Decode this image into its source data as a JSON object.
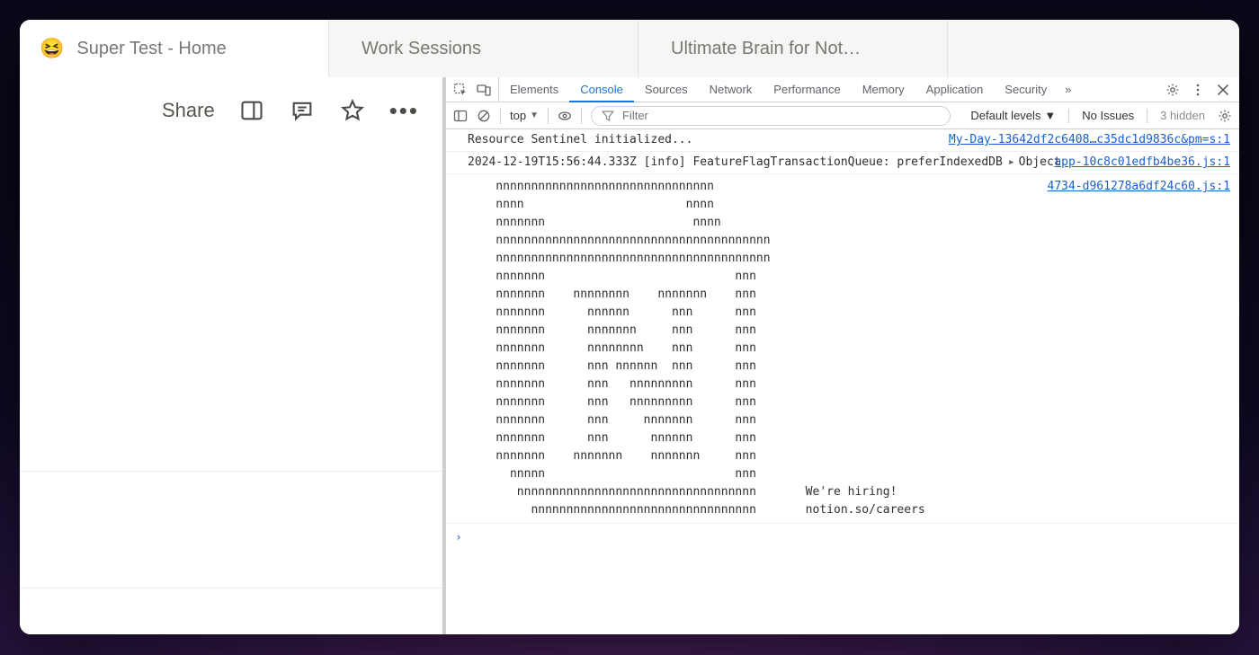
{
  "tabs": [
    {
      "icon": "😆",
      "label": "Super Test - Home",
      "active": true
    },
    {
      "icon": "clock",
      "label": "Work Sessions",
      "active": false
    },
    {
      "icon": "home",
      "label": "Ultimate Brain for Not…",
      "active": false
    }
  ],
  "topbar": {
    "share_label": "Share"
  },
  "devtools": {
    "panels": [
      "Elements",
      "Console",
      "Sources",
      "Network",
      "Performance",
      "Memory",
      "Application",
      "Security"
    ],
    "active_panel": "Console",
    "more_glyph": "»",
    "context_label": "top",
    "filter_placeholder": "Filter",
    "levels_label": "Default levels",
    "issues_label": "No Issues",
    "hidden_label": "3 hidden"
  },
  "console": {
    "rows": [
      {
        "msg": "Resource Sentinel initialized...",
        "src": "My-Day-13642df2c6408…c35dc1d9836c&pm=s:1"
      },
      {
        "msg": "2024-12-19T15:56:44.333Z [info] FeatureFlagTransactionQueue: preferIndexedDB",
        "obj": "Object",
        "src": "app-10c8c01edfb4be36.js:1"
      }
    ],
    "ascii_src": "4734-d961278a6df24c60.js:1",
    "ascii": "    nnnnnnnnnnnnnnnnnnnnnnnnnnnnnnn\n    nnnn                       nnnn\n    nnnnnnn                     nnnn\n    nnnnnnnnnnnnnnnnnnnnnnnnnnnnnnnnnnnnnnn\n    nnnnnnnnnnnnnnnnnnnnnnnnnnnnnnnnnnnnnnn\n    nnnnnnn                           nnn\n    nnnnnnn    nnnnnnnn    nnnnnnn    nnn\n    nnnnnnn      nnnnnn      nnn      nnn\n    nnnnnnn      nnnnnnn     nnn      nnn\n    nnnnnnn      nnnnnnnn    nnn      nnn\n    nnnnnnn      nnn nnnnnn  nnn      nnn\n    nnnnnnn      nnn   nnnnnnnnn      nnn\n    nnnnnnn      nnn   nnnnnnnnn      nnn\n    nnnnnnn      nnn     nnnnnnn      nnn\n    nnnnnnn      nnn      nnnnnn      nnn\n    nnnnnnn    nnnnnnn    nnnnnnn     nnn\n      nnnnn                           nnn\n       nnnnnnnnnnnnnnnnnnnnnnnnnnnnnnnnnn       We're hiring!\n         nnnnnnnnnnnnnnnnnnnnnnnnnnnnnnnn       notion.so/careers",
    "prompt": "›"
  }
}
